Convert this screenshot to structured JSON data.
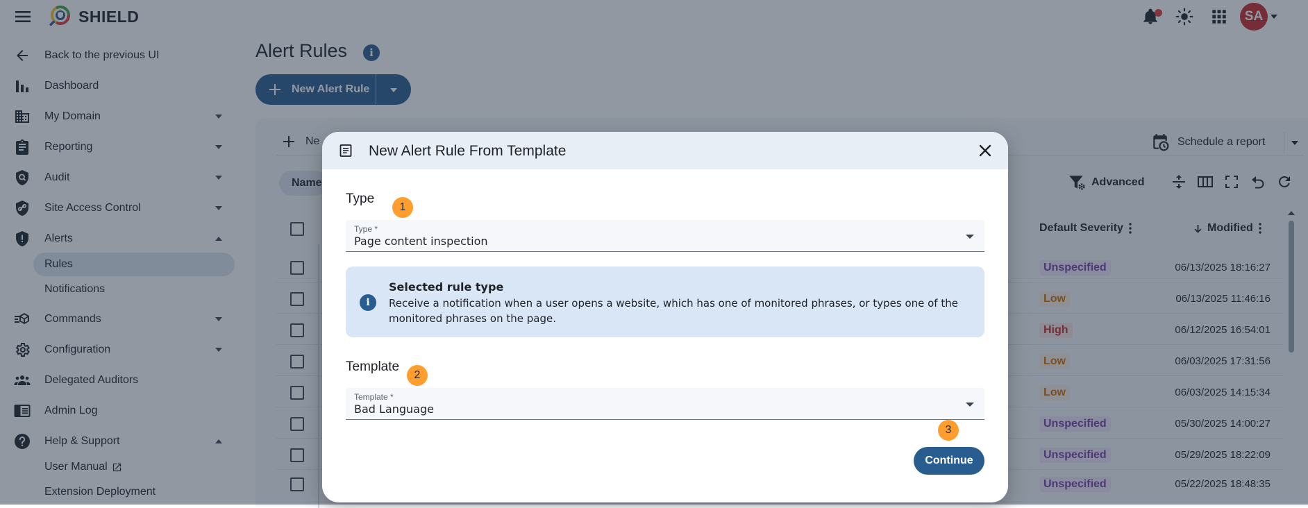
{
  "app": {
    "brand": "SHIELD",
    "avatar_initials": "SA"
  },
  "sidebar": {
    "back": "Back to the previous UI",
    "items": [
      {
        "label": "Dashboard"
      },
      {
        "label": "My Domain"
      },
      {
        "label": "Reporting"
      },
      {
        "label": "Audit"
      },
      {
        "label": "Site Access Control"
      },
      {
        "label": "Alerts"
      },
      {
        "label": "Commands"
      },
      {
        "label": "Configuration"
      },
      {
        "label": "Delegated Auditors"
      },
      {
        "label": "Admin Log"
      },
      {
        "label": "Help & Support"
      }
    ],
    "alerts_sub": [
      {
        "label": "Rules"
      },
      {
        "label": "Notifications"
      }
    ],
    "help_sub": [
      {
        "label": "User Manual"
      },
      {
        "label": "Extension Deployment"
      }
    ]
  },
  "main": {
    "title": "Alert Rules",
    "new_rule_button": "New Alert Rule",
    "toolbar_new": "Ne",
    "schedule_report": "Schedule a report",
    "filter_chip": "Name",
    "advanced": "Advanced",
    "table": {
      "col_severity": "Default Severity",
      "col_modified": "Modified",
      "rows": [
        {
          "severity": "Unspecified",
          "severity_class": "unspecified",
          "modified": "06/13/2025 18:16:27"
        },
        {
          "severity": "Low",
          "severity_class": "low",
          "modified": "06/13/2025 11:46:16"
        },
        {
          "severity": "High",
          "severity_class": "high",
          "modified": "06/12/2025 16:54:01"
        },
        {
          "severity": "Low",
          "severity_class": "low",
          "modified": "06/03/2025 17:31:56"
        },
        {
          "severity": "Low",
          "severity_class": "low",
          "modified": "06/03/2025 14:15:34"
        },
        {
          "severity": "Unspecified",
          "severity_class": "unspecified",
          "modified": "05/30/2025 14:00:27"
        },
        {
          "severity": "Unspecified",
          "severity_class": "unspecified",
          "modified": "05/29/2025 18:22:09"
        },
        {
          "severity": "Unspecified",
          "severity_class": "unspecified",
          "modified": "05/22/2025 18:48:35"
        }
      ]
    }
  },
  "dialog": {
    "title": "New Alert Rule From Template",
    "type_section": "Type",
    "type_field_label": "Type *",
    "type_value": "Page content inspection",
    "info_title": "Selected rule type",
    "info_desc": "Receive a notification when a user opens a website, which has one of monitored phrases, or types one of the monitored phrases on the page.",
    "template_section": "Template",
    "template_field_label": "Template *",
    "template_value": "Bad Language",
    "continue": "Continue",
    "steps": [
      "1",
      "2",
      "3"
    ]
  },
  "colors": {
    "accent": "#2a5d8f",
    "step_badge": "#ff9d2e",
    "avatar": "#c62828"
  }
}
